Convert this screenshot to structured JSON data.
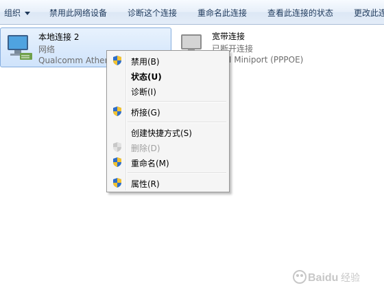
{
  "toolbar": {
    "organize": "组织",
    "disable_device": "禁用此网络设备",
    "diagnose": "诊断这个连接",
    "rename": "重命名此连接",
    "view_status": "查看此连接的状态",
    "change_settings": "更改此连"
  },
  "connections": [
    {
      "name": "本地连接 2",
      "status": "网络",
      "device": "Qualcomm Atheros"
    },
    {
      "name": "宽带连接",
      "status": "已断开连接",
      "device": "WAN Miniport (PPPOE)"
    }
  ],
  "menu": {
    "items": [
      {
        "label": "禁用(B)",
        "icon": "uac-shield-icon"
      },
      {
        "label": "状态(U)",
        "icon": ""
      },
      {
        "label": "诊断(I)",
        "icon": ""
      },
      {
        "label": "桥接(G)",
        "icon": "uac-shield-icon"
      },
      {
        "label": "创建快捷方式(S)",
        "icon": ""
      },
      {
        "label": "删除(D)",
        "icon": "uac-shield-disabled-icon"
      },
      {
        "label": "重命名(M)",
        "icon": "uac-shield-icon"
      },
      {
        "label": "属性(R)",
        "icon": "uac-shield-icon"
      }
    ]
  },
  "watermark": {
    "text": "Baidu 经验"
  },
  "colors": {
    "toolbar_text": "#1e395b",
    "selection": "#cfe3fb",
    "disabled": "#a0a0a0"
  }
}
